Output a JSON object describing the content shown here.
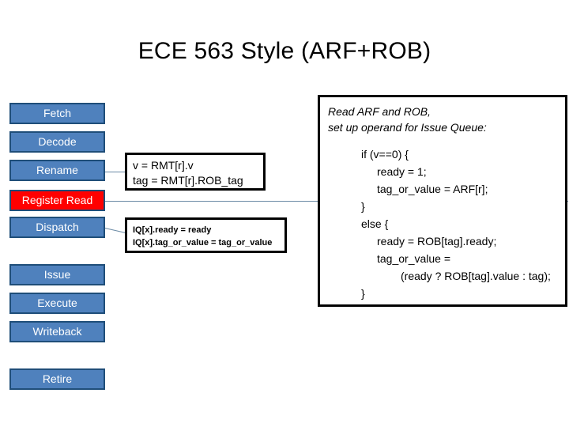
{
  "slide": {
    "title": "ECE 563 Style (ARF+ROB)"
  },
  "pipeline": {
    "stages": [
      {
        "label": "Fetch",
        "state": "normal"
      },
      {
        "label": "Decode",
        "state": "normal"
      },
      {
        "label": "Rename",
        "state": "normal"
      },
      {
        "label": "Register Read",
        "state": "highlight"
      },
      {
        "label": "Dispatch",
        "state": "normal"
      },
      {
        "label": "Issue",
        "state": "normal"
      },
      {
        "label": "Execute",
        "state": "normal"
      },
      {
        "label": "Writeback",
        "state": "normal"
      },
      {
        "label": "Retire",
        "state": "normal"
      }
    ]
  },
  "callouts": {
    "rename": {
      "lines": [
        "v = RMT[r].v",
        "tag = RMT[r].ROB_tag"
      ]
    },
    "dispatch": {
      "lines": [
        "IQ[x].ready = ready",
        "IQ[x].tag_or_value = tag_or_value"
      ]
    }
  },
  "right_panel": {
    "header": [
      "Read ARF and ROB,",
      "set up operand for Issue Queue:"
    ],
    "code": [
      "if (v==0) {",
      "ready = 1;",
      "tag_or_value = ARF[r];",
      "}",
      "else {",
      "ready = ROB[tag].ready;",
      "tag_or_value =",
      "(ready ? ROB[tag].value : tag);",
      "}"
    ]
  },
  "colors": {
    "stage_fill": "#4f81bd",
    "stage_border": "#1f4e79",
    "stage_highlight_fill": "#ff0000",
    "stage_text": "#ffffff",
    "connector": "#6a8aa5",
    "panel_border": "#000000",
    "background": "#ffffff",
    "text": "#000000"
  }
}
